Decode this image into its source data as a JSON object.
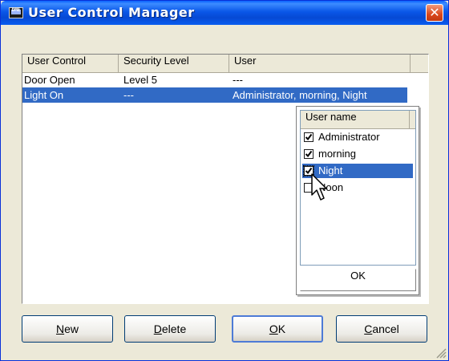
{
  "window": {
    "title": "User Control Manager",
    "app_icon_text": "DME"
  },
  "list": {
    "columns": [
      "User Control",
      "Security Level",
      "User"
    ],
    "rows": [
      {
        "control": "Door  Open",
        "level": "Level 5",
        "user": "---",
        "selected": false
      },
      {
        "control": "Light  On",
        "level": "---",
        "user": "Administrator, morning, Night",
        "selected": true
      }
    ]
  },
  "popup": {
    "header": "User name",
    "items": [
      {
        "label": "Administrator",
        "checked": true
      },
      {
        "label": "morning",
        "checked": true
      },
      {
        "label": "Night",
        "checked": true,
        "highlighted": true
      },
      {
        "label": "Noon",
        "checked": false
      }
    ],
    "ok_label": "OK"
  },
  "buttons": {
    "new": {
      "mnemonic": "N",
      "rest": "ew"
    },
    "delete": {
      "mnemonic": "D",
      "rest": "elete"
    },
    "ok": {
      "mnemonic": "O",
      "rest": "K"
    },
    "cancel": {
      "mnemonic": "C",
      "rest": "ancel"
    }
  },
  "colors": {
    "title_bar": "#0a57e8",
    "selection": "#316ac5",
    "dialog_bg": "#ece9d8",
    "close_button": "#d9461c"
  },
  "icons": [
    "dme-app-icon",
    "close-icon",
    "checkbox-icon",
    "mouse-pointer-icon",
    "resize-grip-icon"
  ]
}
